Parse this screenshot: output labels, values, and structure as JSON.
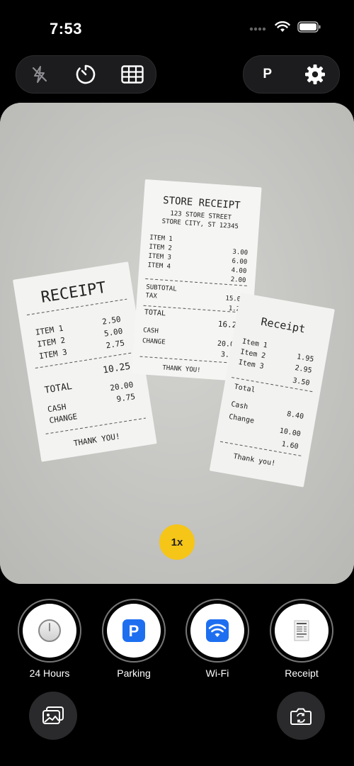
{
  "status": {
    "time": "7:53"
  },
  "top_bar": {
    "profile_letter": "P"
  },
  "zoom": {
    "label": "1x"
  },
  "modes": [
    {
      "label": "24 Hours",
      "icon": "clock-icon"
    },
    {
      "label": "Parking",
      "icon": "parking-icon"
    },
    {
      "label": "Wi-Fi",
      "icon": "wifi-icon"
    },
    {
      "label": "Receipt",
      "icon": "receipt-icon"
    }
  ],
  "receipt_left": {
    "title": "RECEIPT",
    "items": [
      {
        "name": "ITEM 1",
        "price": "2.50"
      },
      {
        "name": "ITEM 2",
        "price": "5.00"
      },
      {
        "name": "ITEM 3",
        "price": "2.75"
      }
    ],
    "total_value": "10.25",
    "total_label": "TOTAL",
    "cash_label": "CASH",
    "cash_value": "20.00",
    "change_label": "CHANGE",
    "change_value": "9.75",
    "thanks": "THANK YOU!"
  },
  "receipt_middle": {
    "title": "STORE RECEIPT",
    "address1": "123 STORE STREET",
    "address2": "STORE CITY, ST 12345",
    "items": [
      {
        "name": "ITEM 1",
        "price": "3.00"
      },
      {
        "name": "ITEM 2",
        "price": "6.00"
      },
      {
        "name": "ITEM 3",
        "price": "4.00"
      },
      {
        "name": "ITEM 4",
        "price": "2.00"
      }
    ],
    "subtotal_label": "SUBTOTAL",
    "subtotal_value": "15.00",
    "tax_label": "TAX",
    "tax_value": "1.20",
    "total_label": "TOTAL",
    "total_value": "16.20",
    "cash_label": "CASH",
    "cash_value": "20.00",
    "change_label": "CHANGE",
    "change_value": "3.80",
    "thanks": "THANK YOU!"
  },
  "receipt_right": {
    "title": "Receipt",
    "items": [
      {
        "name": "Item 1",
        "price": "1.95"
      },
      {
        "name": "Item 2",
        "price": "2.95"
      },
      {
        "name": "Item 3",
        "price": "3.50"
      }
    ],
    "total_label": "Total",
    "cash_label": "Cash",
    "cash_value": "8.40",
    "change_label": "Change",
    "change_value": "10.00",
    "extra_value": "1.60",
    "thanks": "Thank you!"
  }
}
